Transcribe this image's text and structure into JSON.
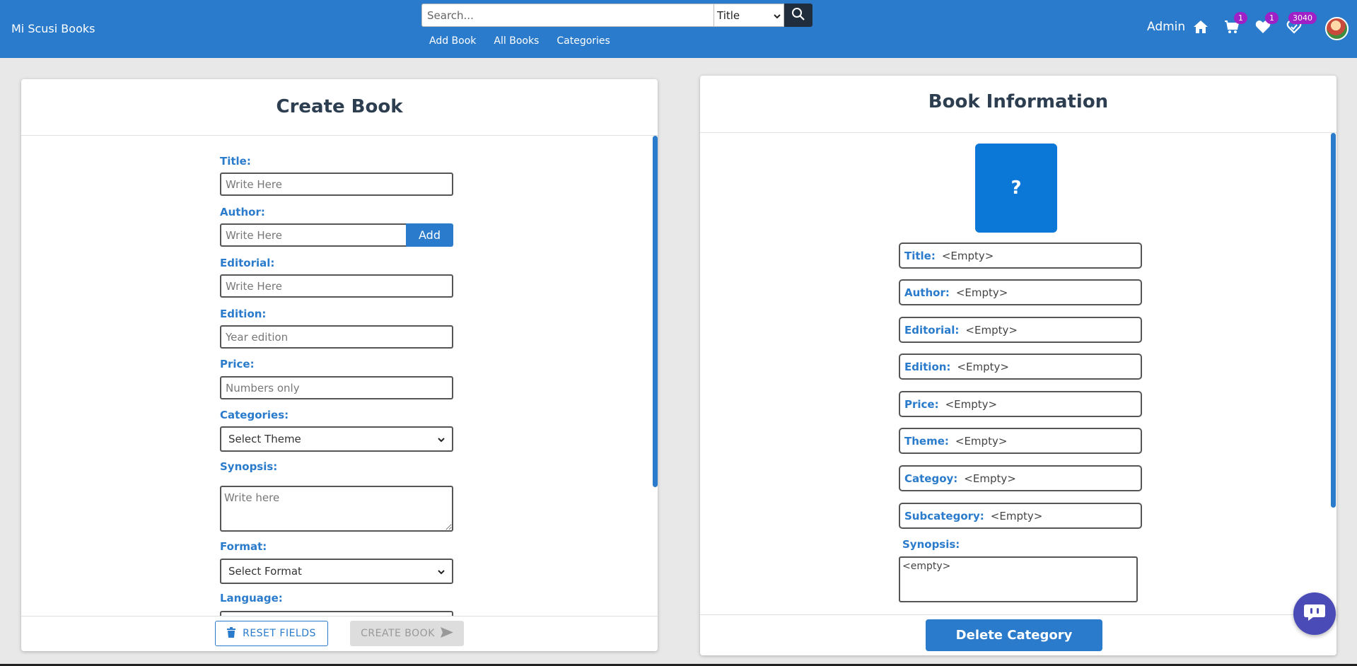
{
  "brand": "Mi Scusi Books",
  "search": {
    "placeholder": "Search...",
    "selected": "Title"
  },
  "nav": {
    "links": [
      "Add Book",
      "All Books",
      "Categories"
    ]
  },
  "user": {
    "name": "Admin"
  },
  "badges": {
    "cart": "1",
    "wishlist": "1",
    "orders": "3040"
  },
  "create": {
    "title": "Create Book",
    "labels": {
      "title": "Title:",
      "author": "Author:",
      "editorial": "Editorial:",
      "edition": "Edition:",
      "price": "Price:",
      "categories": "Categories:",
      "synopsis": "Synopsis:",
      "format": "Format:",
      "language": "Language:"
    },
    "placeholders": {
      "title": "Write Here",
      "author": "Write Here",
      "editorial": "Write Here",
      "edition": "Year edition",
      "price": "Numbers only",
      "synopsis": "Write here"
    },
    "selects": {
      "categories": "Select Theme",
      "format": "Select Format"
    },
    "add_label": "Add",
    "reset_label": "RESET FIELDS",
    "create_label": "CREATE BOOK"
  },
  "info": {
    "title": "Book Information",
    "cover_symbol": "?",
    "fields": [
      {
        "key": "Title:",
        "value": "<Empty>"
      },
      {
        "key": "Author:",
        "value": "<Empty>"
      },
      {
        "key": "Editorial:",
        "value": "<Empty>"
      },
      {
        "key": "Edition:",
        "value": "<Empty>"
      },
      {
        "key": "Price:",
        "value": "<Empty>"
      },
      {
        "key": "Theme:",
        "value": "<Empty>"
      },
      {
        "key": "Categoy:",
        "value": "<Empty>"
      },
      {
        "key": "Subcategory:",
        "value": "<Empty>"
      }
    ],
    "synopsis_label": "Synopsis:",
    "synopsis_value": "<empty>",
    "delete_label": "Delete Category"
  },
  "colors": {
    "primary": "#2a7bcb",
    "badge": "#a020c8",
    "dark": "#1f2d3d"
  }
}
